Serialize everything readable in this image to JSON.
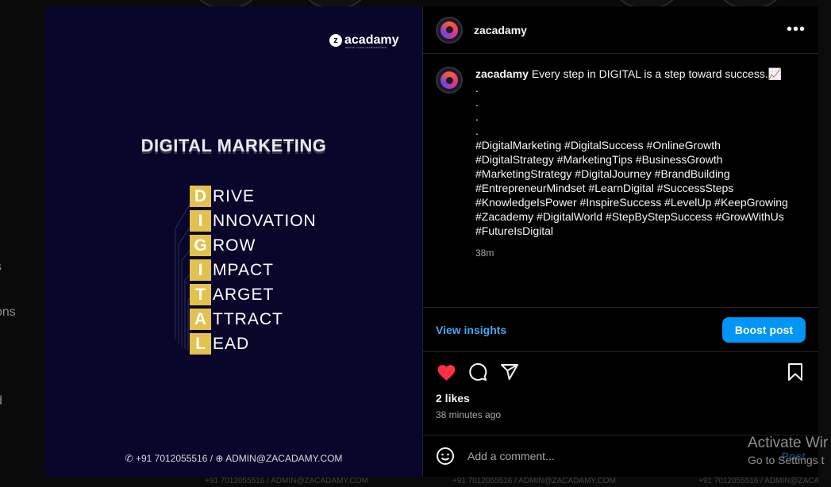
{
  "background": {
    "side_labels": [
      "s",
      "ons",
      "d"
    ],
    "footer_text": "+91 7012055516 / ADMIN@ZACADAMY.COM"
  },
  "post_image": {
    "logo_text": "acadamy",
    "logo_mark": "z",
    "logo_tagline": "WRITE YOUR INSPIRATIONS",
    "headline": "DIGITAL MARKETING",
    "acronym": [
      {
        "letter": "D",
        "rest": "RIVE"
      },
      {
        "letter": "I",
        "rest": "NNOVATION"
      },
      {
        "letter": "G",
        "rest": "ROW"
      },
      {
        "letter": "I",
        "rest": "MPACT"
      },
      {
        "letter": "T",
        "rest": "ARGET"
      },
      {
        "letter": "A",
        "rest": "TTRACT"
      },
      {
        "letter": "L",
        "rest": "EAD"
      }
    ],
    "contact": "+91 7012055516 / ",
    "email": "ADMIN@ZACADAMY.COM",
    "accent_color": "#e3c14f"
  },
  "panel": {
    "username": "zacadamy",
    "caption": {
      "username": "zacadamy",
      "text": " Every step in DIGITAL is a step toward success.📈",
      "dots": [
        ".",
        ".",
        ".",
        "."
      ],
      "hashtag_lines": [
        "#DigitalMarketing #DigitalSuccess #OnlineGrowth",
        "#DigitalStrategy #MarketingTips #BusinessGrowth",
        "#MarketingStrategy #DigitalJourney #BrandBuilding",
        "#EntrepreneurMindset #LearnDigital #SuccessSteps",
        "#KnowledgeIsPower #InspireSuccess #LevelUp #KeepGrowing",
        "#Zacademy #DigitalWorld #StepByStepSuccess #GrowWithUs",
        "#FutureIsDigital"
      ],
      "time": "38m"
    },
    "view_insights": "View insights",
    "boost_post": "Boost post",
    "likes": "2 likes",
    "posted_ago": "38 minutes ago",
    "comment_placeholder": "Add a comment...",
    "post_label": "Post"
  },
  "watermark": {
    "title": "Activate Wir",
    "subtitle": "Go to Settings t"
  }
}
